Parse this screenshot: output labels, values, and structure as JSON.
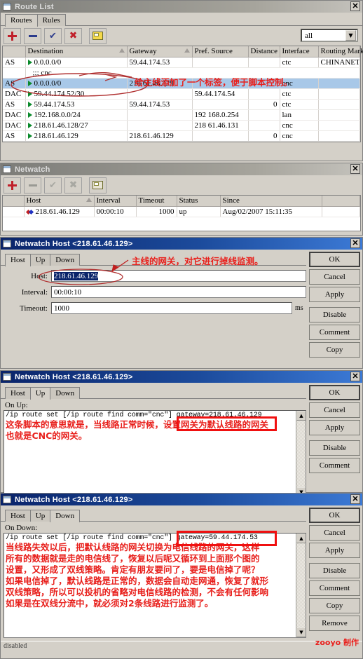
{
  "colors": {
    "title_active_start": "#0a246a",
    "title_active_end": "#3c7ad6",
    "title_inactive": "#7c7c78",
    "face": "#d4d0c8",
    "selection": "#a8c8e8",
    "annotation_red": "#e8201c",
    "highlight_box_red": "#f01010"
  },
  "route_list": {
    "title": "Route List",
    "close_label": "✕",
    "tabs": [
      {
        "label": "Routes",
        "selected": true
      },
      {
        "label": "Rules",
        "selected": false
      }
    ],
    "toolbar": {
      "add": "add-icon",
      "remove": "remove-icon",
      "enable": "enable-icon",
      "disable": "disable-icon",
      "comment": "comment-icon",
      "filter_value": "all",
      "filter_arrow": "▼"
    },
    "columns": [
      "",
      "Destination",
      "Gateway",
      "Pref. Source",
      "Distance",
      "Interface",
      "Routing Mark"
    ],
    "rows": [
      {
        "flags": "AS",
        "destination": "0.0.0.0/0",
        "gateway": "59.44.174.53",
        "pref_source": "",
        "distance": "",
        "interface": "ctc",
        "routing_mark": "CHINANET",
        "selected": false,
        "comment": ""
      },
      {
        "flags": "",
        "destination": ";;; cnc",
        "gateway": "",
        "pref_source": "",
        "distance": "",
        "interface": "",
        "routing_mark": "",
        "selected": false,
        "is_comment": true
      },
      {
        "flags": "AS",
        "destination": "0.0.0.0/0",
        "gateway": "218.61.46.129",
        "pref_source": "",
        "distance": "",
        "interface": "cnc",
        "routing_mark": "",
        "selected": true,
        "comment": ""
      },
      {
        "flags": "DAC",
        "destination": "59.44.174.52/30",
        "gateway": "",
        "pref_source": "59.44.174.54",
        "distance": "",
        "interface": "ctc",
        "routing_mark": "",
        "selected": false
      },
      {
        "flags": "AS",
        "destination": "59.44.174.53",
        "gateway": "59.44.174.53",
        "pref_source": "",
        "distance": "0",
        "interface": "ctc",
        "routing_mark": "",
        "selected": false
      },
      {
        "flags": "DAC",
        "destination": "192.168.0.0/24",
        "gateway": "",
        "pref_source": "192 168.0.254",
        "distance": "",
        "interface": "lan",
        "routing_mark": "",
        "selected": false
      },
      {
        "flags": "DAC",
        "destination": "218.61.46.128/27",
        "gateway": "",
        "pref_source": "218 61.46.131",
        "distance": "",
        "interface": "cnc",
        "routing_mark": "",
        "selected": false
      },
      {
        "flags": "AS",
        "destination": "218.61.46.129",
        "gateway": "218.61.46.129",
        "pref_source": "",
        "distance": "0",
        "interface": "cnc",
        "routing_mark": "",
        "selected": false
      }
    ],
    "annotation": "给主线添加了一个标签，便于脚本控制。"
  },
  "netwatch": {
    "title": "Netwatch",
    "close_label": "✕",
    "toolbar": {
      "add": "add-icon",
      "remove": "remove-icon",
      "enable": "enable-icon",
      "disable": "disable-icon",
      "comment": "comment-icon"
    },
    "columns": [
      "",
      "Host",
      "Interval",
      "Timeout",
      "Status",
      "Since",
      ""
    ],
    "rows": [
      {
        "host": "218.61.46.129",
        "interval": "00:00:10",
        "timeout": "1000",
        "status": "up",
        "since": "Aug/02/2007 15:11:35"
      }
    ]
  },
  "dialog_host": {
    "title": "Netwatch Host <218.61.46.129>",
    "close_label": "✕",
    "tabs": [
      {
        "label": "Host",
        "selected": true
      },
      {
        "label": "Up",
        "selected": false
      },
      {
        "label": "Down",
        "selected": false
      }
    ],
    "fields": {
      "host_label": "Host:",
      "host_value": "218.61.46.129",
      "interval_label": "Interval:",
      "interval_value": "00:00:10",
      "timeout_label": "Timeout:",
      "timeout_value": "1000",
      "timeout_unit": "ms"
    },
    "buttons": [
      "OK",
      "Cancel",
      "Apply",
      "Disable",
      "Comment",
      "Copy"
    ],
    "annotation": "主线的网关，对它进行掉线监测。"
  },
  "dialog_up": {
    "title": "Netwatch Host <218.61.46.129>",
    "close_label": "✕",
    "tabs": [
      {
        "label": "Host",
        "selected": false
      },
      {
        "label": "Up",
        "selected": true
      },
      {
        "label": "Down",
        "selected": false
      }
    ],
    "script_label": "On Up:",
    "script_code": "/ip route set [/ip route find comm=\"cnc\"] gateway=218.61.46.129",
    "script_code_prefix": "/ip route set [/ip route find comm=\"cnc\"] ",
    "script_code_boxed": "gateway=218.61.46.129",
    "annotation_lines": [
      "这条脚本的意思就是，当线路正常时候，设置网关为默认线路的网关",
      "也就是CNC的网关。"
    ],
    "buttons": [
      "OK",
      "Cancel",
      "Apply",
      "Disable",
      "Comment"
    ]
  },
  "dialog_down": {
    "title": "Netwatch Host <218.61.46.129>",
    "close_label": "✕",
    "tabs": [
      {
        "label": "Host",
        "selected": false
      },
      {
        "label": "Up",
        "selected": false
      },
      {
        "label": "Down",
        "selected": true
      }
    ],
    "script_label": "On Down:",
    "script_code_prefix": "/ip route set [/ip route find comm=\"cnc\"] ",
    "script_code_boxed": "gateway=59.44.174.53",
    "annotation_lines": [
      "当线路失效以后，把默认线路的网关切换为电信线路的网关，这样",
      "所有的数据就是走的电信线了，恢复以后呢又循环到上面那个图的",
      "设置，又形成了双线策略。肯定有朋友要问了，要是电信掉了呢？",
      "如果电信掉了，默认线路是正常的，数据会自动走网通，恢复了就形",
      "双线策略，所以可以投机的省略对电信线路的检测，不会有任何影响",
      "如果是在双线分流中，就必须对2条线路进行监测了。"
    ],
    "buttons": [
      "OK",
      "Cancel",
      "Apply",
      "Disable",
      "Comment",
      "Copy",
      "Remove"
    ],
    "status": "disabled"
  },
  "watermark": "zooyo 制作"
}
